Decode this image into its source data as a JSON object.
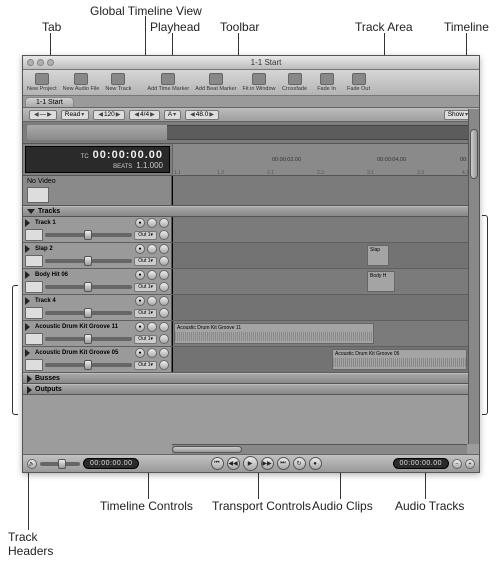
{
  "labels": {
    "tab": "Tab",
    "global_timeline_view": "Global Timeline View",
    "playhead": "Playhead",
    "toolbar": "Toolbar",
    "track_area": "Track Area",
    "timeline": "Timeline",
    "timeline_controls": "Timeline Controls",
    "transport_controls": "Transport Controls",
    "audio_clips": "Audio Clips",
    "audio_tracks": "Audio Tracks",
    "track_headers": "Track\nHeaders"
  },
  "window": {
    "title": "1-1 Start"
  },
  "toolbar": {
    "new_project": "New Project",
    "new_audio_file": "New Audio File",
    "new_track": "New Track",
    "add_time_marker": "Add Time Marker",
    "add_beat_marker": "Add Beat Marker",
    "fit_in_window": "Fit in Window",
    "crossfade": "Crossfade",
    "fade_in": "Fade In",
    "fade_out": "Fade Out"
  },
  "tab_name": "1-1 Start",
  "option_bar": {
    "read": "Read",
    "tempo": "120",
    "sig": "4/4",
    "key": "A",
    "rate": "48.0",
    "show": "Show"
  },
  "counter": {
    "tc_label": "TC",
    "tc": "00:00:00.00",
    "beats_label": "BEATS",
    "beats": "1.1.000"
  },
  "ruler": {
    "t0": "",
    "t1": "00:00:02.00",
    "t2": "00:00:04.00",
    "t3": "00:",
    "s1": "1.1",
    "s2": "1.3",
    "s3": "2.1",
    "s4": "2.3",
    "s5": "3.1",
    "s6": "3.3",
    "s7": "4.1"
  },
  "video_label": "No Video",
  "sections": {
    "tracks": "Tracks",
    "busses": "Busses",
    "outputs": "Outputs"
  },
  "tracks": [
    {
      "name": "Track 1",
      "out": "Out 1"
    },
    {
      "name": "Slap 2",
      "out": "Out 1"
    },
    {
      "name": "Body Hit 06",
      "out": "Out 1"
    },
    {
      "name": "Track 4",
      "out": "Out 1"
    },
    {
      "name": "Acoustic Drum Kit Groove 11",
      "out": "Out 1"
    },
    {
      "name": "Acoustic Drum Kit Groove 05",
      "out": "Out 1"
    }
  ],
  "clips": {
    "slap": "Slap",
    "body": "Body H",
    "groove11": "Acoustic Drum Kit Groove 11",
    "groove05": "Acoustic Drum Kit Groove 05"
  },
  "transport": {
    "tc_left": "00:00:00.00",
    "tc_right": "00:00:00.00"
  }
}
